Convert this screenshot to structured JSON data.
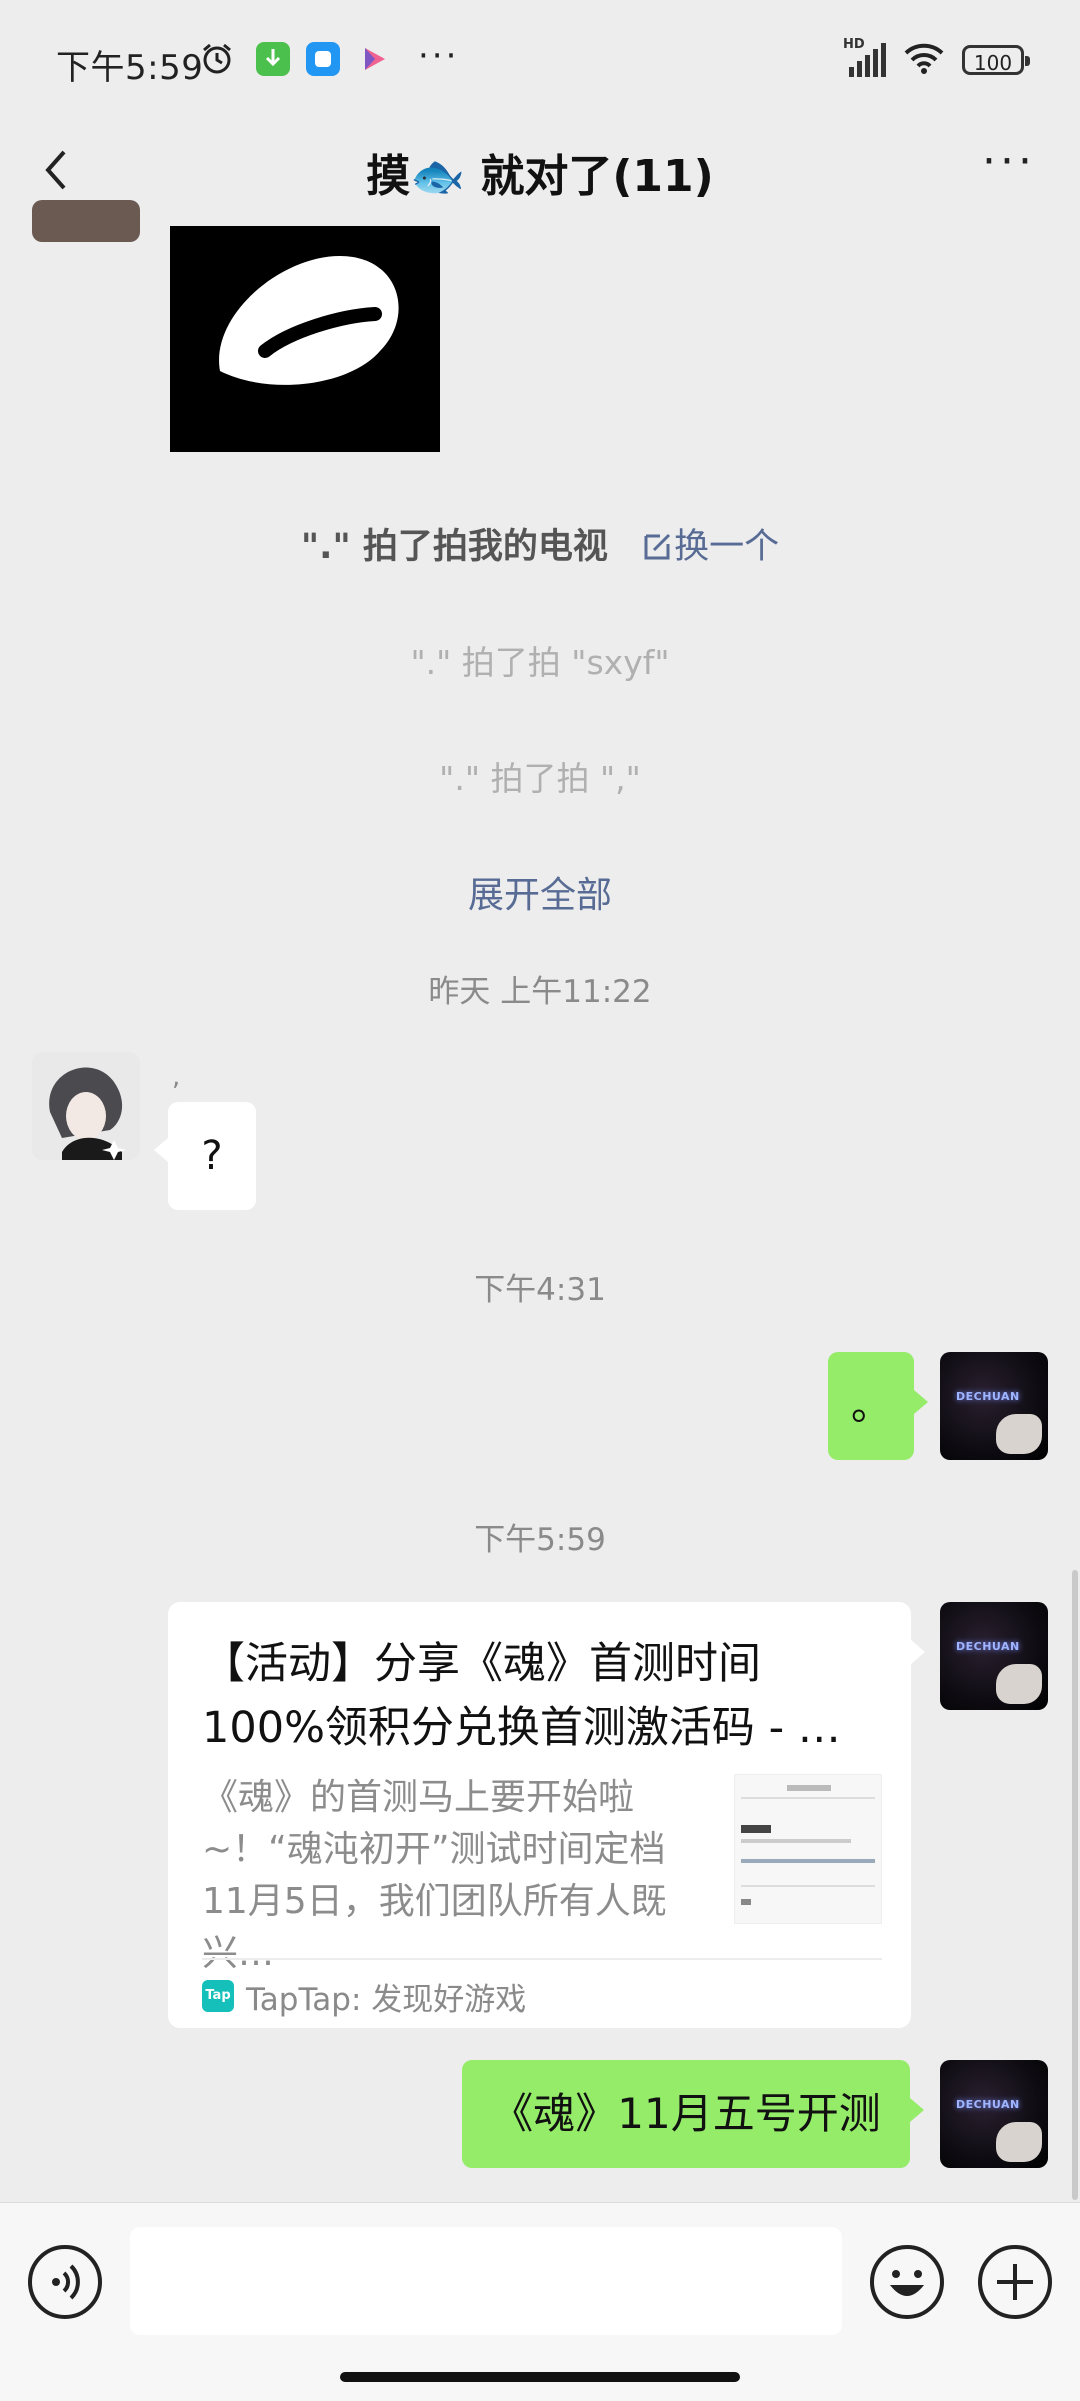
{
  "status_bar": {
    "time": "下午5:59",
    "network": "HD",
    "battery": "100"
  },
  "header": {
    "title": "摸🐟 就对了(11)",
    "more": "···"
  },
  "messages": {
    "pat_main_text": "\".\" 拍了拍我的电视",
    "pat_change": "换一个",
    "pat_sxyf": "\".\" 拍了拍 \"sxyf\"",
    "pat_comma": "\".\" 拍了拍 \",\"",
    "expand_all": "展开全部",
    "time_1": "昨天 上午11:22",
    "other_name": ",",
    "other_msg": "?",
    "time_2": "下午4:31",
    "self_msg_1": "。",
    "time_3": "下午5:59",
    "self_msg_2": "《魂》11月五号开测"
  },
  "link_card": {
    "title": "【活动】分享《魂》首测时间100%领积分兑换首测激活码 - …",
    "description": "《魂》的首测马上要开始啦~！“魂沌初开”测试时间定档11月5日，我们团队所有人既兴…",
    "source": "TapTap: 发现好游戏",
    "source_logo": "Tap"
  },
  "avatar_self_text": "DECHUAN",
  "colors": {
    "self_bubble": "#95ec69",
    "link_blue": "#576b95",
    "background": "#ededed"
  },
  "icons": [
    "alarm-icon",
    "download-icon",
    "app-icon",
    "play-icon",
    "back-icon",
    "more-icon",
    "edit-icon",
    "voice-icon",
    "emoji-icon",
    "plus-icon",
    "wifi-icon",
    "signal-icon",
    "battery-icon"
  ]
}
